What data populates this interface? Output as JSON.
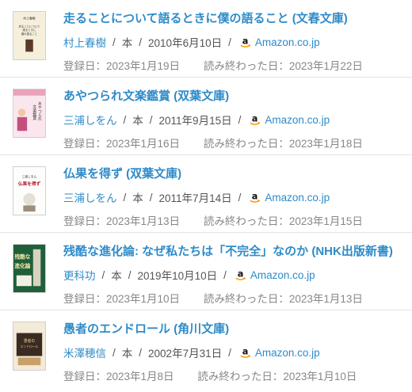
{
  "books": [
    {
      "title": "走ることについて語るときに僕の語ること (文春文庫)",
      "author": "村上春樹",
      "type": "本",
      "pub_date": "2010年6月10日",
      "store": "Amazon.co.jp",
      "registered": "登録日：2023年1月19日",
      "finished": "読み終わった日：2023年1月22日",
      "cover_text": [
        "村上春樹",
        "走ることについて",
        "語るときに",
        "僕の語ること"
      ]
    },
    {
      "title": "あやつられ文楽鑑賞 (双葉文庫)",
      "author": "三浦しをん",
      "type": "本",
      "pub_date": "2011年9月15日",
      "store": "Amazon.co.jp",
      "registered": "登録日：2023年1月16日",
      "finished": "読み終わった日：2023年1月18日",
      "cover_text": [
        "あやつられ",
        "文楽鑑賞"
      ]
    },
    {
      "title": "仏果を得ず (双葉文庫)",
      "author": "三浦しをん",
      "type": "本",
      "pub_date": "2011年7月14日",
      "store": "Amazon.co.jp",
      "registered": "登録日：2023年1月13日",
      "finished": "読み終わった日：2023年1月15日",
      "cover_text": [
        "三浦しをん",
        "仏果を得ず"
      ]
    },
    {
      "title": "残酷な進化論: なぜ私たちは「不完全」なのか (NHK出版新書)",
      "author": "更科功",
      "type": "本",
      "pub_date": "2019年10月10日",
      "store": "Amazon.co.jp",
      "registered": "登録日：2023年1月10日",
      "finished": "読み終わった日：2023年1月13日",
      "cover_text": [
        "残酷な",
        "進化論"
      ]
    },
    {
      "title": "愚者のエンドロール (角川文庫)",
      "author": "米澤穂信",
      "type": "本",
      "pub_date": "2002年7月31日",
      "store": "Amazon.co.jp",
      "registered": "登録日：2023年1月8日",
      "finished": "読み終わった日：2023年1月10日",
      "cover_text": [
        "愚者の",
        "エンドロール"
      ]
    }
  ],
  "separator": "/",
  "colors": {
    "link": "#2e8bc9",
    "text": "#555555",
    "muted": "#888888",
    "amazon_orange": "#ff9900"
  },
  "icons": {
    "store": "amazon-logo-icon"
  }
}
